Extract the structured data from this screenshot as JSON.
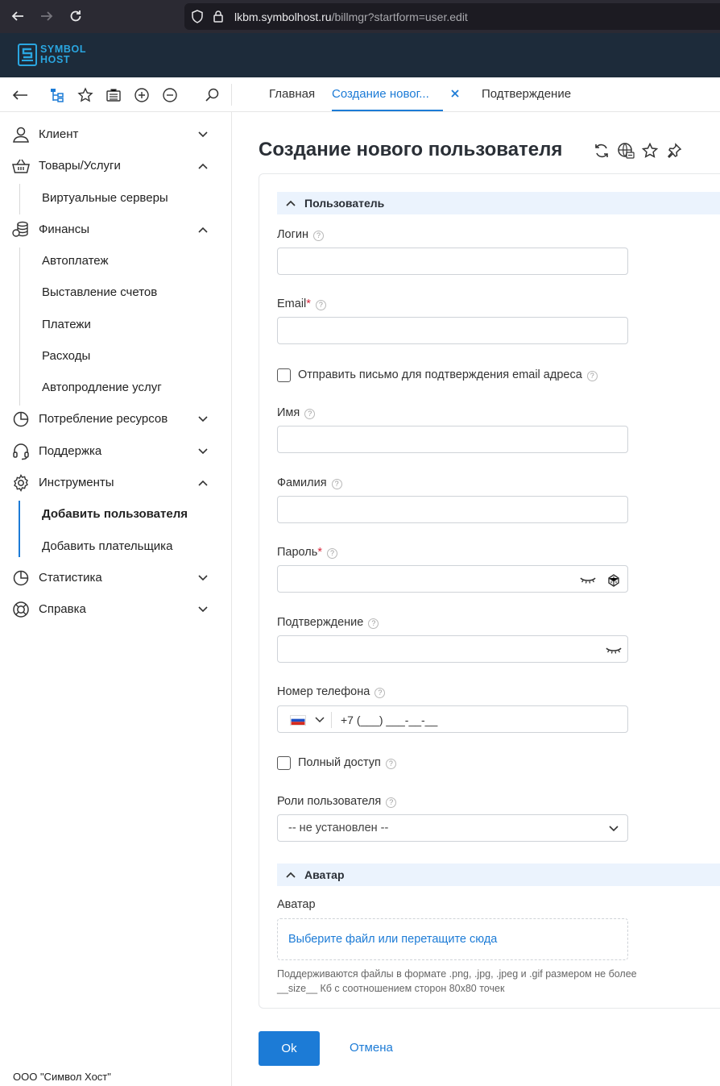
{
  "browser": {
    "url_domain": "lkbm.symbolhost.ru",
    "url_path": "/billmgr?startform=user.edit"
  },
  "app": {
    "logo_line1": "SYMBOL",
    "logo_line2": "HOST",
    "accent_color": "#1c7bd6",
    "header_color": "#1d2b3a"
  },
  "tabs": [
    {
      "label": "Главная"
    },
    {
      "label": "Создание новог..."
    },
    {
      "label": "Подтверждение"
    }
  ],
  "sidebar": {
    "items": [
      {
        "label": "Клиент",
        "icon": "user-icon",
        "expanded": false
      },
      {
        "label": "Товары/Услуги",
        "icon": "basket-icon",
        "expanded": true,
        "children": [
          "Виртуальные серверы"
        ]
      },
      {
        "label": "Финансы",
        "icon": "coins-icon",
        "expanded": true,
        "children": [
          "Автоплатеж",
          "Выставление счетов",
          "Платежи",
          "Расходы",
          "Автопродление услуг"
        ]
      },
      {
        "label": "Потребление ресурсов",
        "icon": "pie-chart-icon",
        "expanded": false
      },
      {
        "label": "Поддержка",
        "icon": "headset-icon",
        "expanded": false
      },
      {
        "label": "Инструменты",
        "icon": "gear-icon",
        "expanded": true,
        "children": [
          "Добавить пользователя",
          "Добавить плательщика"
        ]
      },
      {
        "label": "Статистика",
        "icon": "pie-chart-icon",
        "expanded": false
      },
      {
        "label": "Справка",
        "icon": "lifebuoy-icon",
        "expanded": false
      }
    ],
    "active_child": "Добавить пользователя",
    "footer": "ООО \"Символ Хост\""
  },
  "page": {
    "title": "Создание нового пользователя"
  },
  "form": {
    "section_user": "Пользователь",
    "login_label": "Логин",
    "email_label": "Email",
    "send_confirm_label": "Отправить письмо для подтверждения email адреса",
    "name_label": "Имя",
    "surname_label": "Фамилия",
    "password_label": "Пароль",
    "confirm_label": "Подтверждение",
    "phone_label": "Номер телефона",
    "phone_value": "+7 (___) ___-__-__",
    "full_access_label": "Полный доступ",
    "roles_label": "Роли пользователя",
    "roles_value": "-- не установлен --",
    "section_avatar": "Аватар",
    "avatar_label": "Аватар",
    "avatar_drop": "Выберите файл или перетащите сюда",
    "avatar_hint": "Поддерживаются файлы в формате .png, .jpg, .jpeg и .gif размером не более __size__ Кб с соотношением сторон 80x80 точек",
    "required_mark": "*",
    "help_mark": "?"
  },
  "buttons": {
    "ok": "Ok",
    "cancel": "Отмена"
  }
}
